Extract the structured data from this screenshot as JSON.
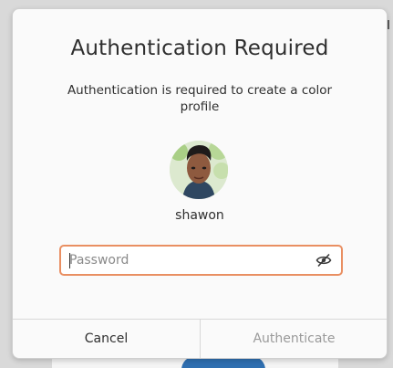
{
  "dialog": {
    "title": "Authentication Required",
    "message": "Authentication is required to create a color profile",
    "username": "shawon",
    "password": {
      "placeholder": "Password",
      "value": ""
    },
    "buttons": {
      "cancel": "Cancel",
      "authenticate": "Authenticate"
    },
    "focus_color": "#e98f62"
  }
}
